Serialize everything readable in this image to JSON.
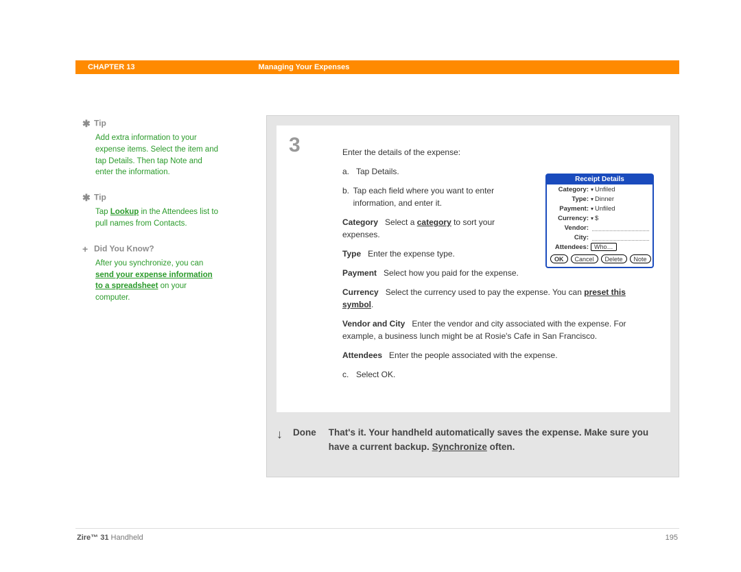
{
  "header": {
    "chapter": "CHAPTER 13",
    "title": "Managing Your Expenses"
  },
  "sidebar": {
    "tips": [
      {
        "heading": "Tip",
        "body_parts": [
          "Add extra information to your expense items. Select the item and tap Details. Then tap Note and enter the information."
        ]
      },
      {
        "heading": "Tip",
        "body_prefix": "Tap ",
        "body_link": "Lookup",
        "body_suffix": " in the Attendees list to pull names from Contacts."
      }
    ],
    "dyk": {
      "heading": "Did You Know?",
      "prefix": "After you synchronize, you can ",
      "link": "send your expense information to a spreadsheet",
      "suffix": " on your computer."
    }
  },
  "step": {
    "number": "3",
    "intro": "Enter the details of the expense:",
    "a_marker": "a.",
    "a_text": "Tap Details.",
    "b_marker": "b.",
    "b_text": "Tap each field where you want to enter information, and enter it.",
    "fields": {
      "category_label": "Category",
      "category_text_pre": "Select a ",
      "category_link": "category",
      "category_text_post": " to sort your expenses.",
      "type_label": "Type",
      "type_text": "Enter the expense type.",
      "payment_label": "Payment",
      "payment_text": "Select how you paid for the expense.",
      "currency_label": "Currency",
      "currency_text_pre": "Select the currency used to pay the expense. You can ",
      "currency_link": "preset this symbol",
      "currency_text_post": ".",
      "vendor_label": "Vendor and City",
      "vendor_text": "Enter the vendor and city associated with the expense. For example, a business lunch might be at Rosie's Cafe in San Francisco.",
      "attendees_label": "Attendees",
      "attendees_text": "Enter the people associated with the expense."
    },
    "c_marker": "c.",
    "c_text": "Select OK."
  },
  "receipt": {
    "title": "Receipt Details",
    "rows": {
      "category_l": "Category:",
      "category_v": "Unfiled",
      "type_l": "Type:",
      "type_v": "Dinner",
      "payment_l": "Payment:",
      "payment_v": "Unfiled",
      "currency_l": "Currency:",
      "currency_v": "$",
      "vendor_l": "Vendor:",
      "city_l": "City:",
      "attendees_l": "Attendees:",
      "who_btn": "Who…"
    },
    "buttons": {
      "ok": "OK",
      "cancel": "Cancel",
      "delete": "Delete",
      "note": "Note"
    }
  },
  "done": {
    "label": "Done",
    "text_pre": "That's it. Your handheld automatically saves the expense. Make sure you have a current backup. ",
    "sync": "Synchronize",
    "text_post": " often."
  },
  "footer": {
    "product_bold": "Zire™ 31",
    "product_rest": " Handheld",
    "page": "195"
  }
}
